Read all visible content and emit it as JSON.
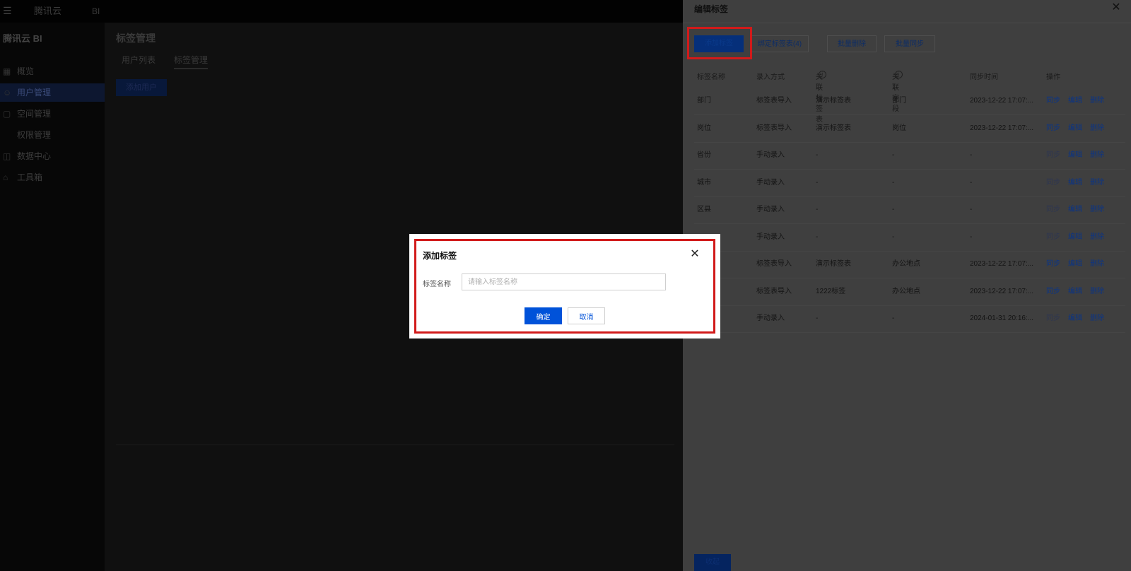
{
  "app": {
    "brand_logo": "腾讯云",
    "product": "BI",
    "sidebar_brand": "腾讯云 BI"
  },
  "sidebar": {
    "items": [
      {
        "label": "概览",
        "icon": "overview-icon"
      },
      {
        "label": "用户管理",
        "icon": "user-icon"
      },
      {
        "label": "空间管理",
        "icon": "space-icon"
      },
      {
        "label": "权限管理",
        "icon": "permission-icon"
      },
      {
        "label": "数据中心",
        "icon": "data-icon"
      },
      {
        "label": "工具箱",
        "icon": "toolbox-icon"
      }
    ]
  },
  "main": {
    "title": "标签管理",
    "tabs": [
      "用户列表",
      "标签管理"
    ],
    "add_button": "添加用户"
  },
  "drawer": {
    "title": "编辑标签",
    "toolbar": {
      "add": "添加标签",
      "bind": "绑定标签表(4)",
      "batch_delete": "批量删除",
      "batch_sync": "批量同步"
    },
    "columns": [
      "标签名称",
      "录入方式",
      "关联标签表",
      "关联字段",
      "同步时间",
      "操作"
    ],
    "rows": [
      {
        "name": "部门",
        "mode": "标签表导入",
        "table": "演示标签表",
        "field": "部门",
        "time": "2023-12-22 17:07:...",
        "sync": "同步",
        "edit": "编辑",
        "del": "删除",
        "sync_enabled": true
      },
      {
        "name": "岗位",
        "mode": "标签表导入",
        "table": "演示标签表",
        "field": "岗位",
        "time": "2023-12-22 17:07:...",
        "sync": "同步",
        "edit": "编辑",
        "del": "删除",
        "sync_enabled": true
      },
      {
        "name": "省份",
        "mode": "手动录入",
        "table": "-",
        "field": "-",
        "time": "-",
        "sync": "同步",
        "edit": "编辑",
        "del": "删除",
        "sync_enabled": false
      },
      {
        "name": "城市",
        "mode": "手动录入",
        "table": "-",
        "field": "-",
        "time": "-",
        "sync": "同步",
        "edit": "编辑",
        "del": "删除",
        "sync_enabled": false
      },
      {
        "name": "区县",
        "mode": "手动录入",
        "table": "-",
        "field": "-",
        "time": "-",
        "sync": "同步",
        "edit": "编辑",
        "del": "删除",
        "sync_enabled": false
      },
      {
        "name": "",
        "mode": "手动录入",
        "table": "-",
        "field": "-",
        "time": "-",
        "sync": "同步",
        "edit": "编辑",
        "del": "删除",
        "sync_enabled": false
      },
      {
        "name": "",
        "mode": "标签表导入",
        "table": "演示标签表",
        "field": "办公地点",
        "time": "2023-12-22 17:07:...",
        "sync": "同步",
        "edit": "编辑",
        "del": "删除",
        "sync_enabled": true
      },
      {
        "name": "",
        "mode": "标签表导入",
        "table": "1222标签",
        "field": "办公地点",
        "time": "2023-12-22 17:07:...",
        "sync": "同步",
        "edit": "编辑",
        "del": "删除",
        "sync_enabled": true
      },
      {
        "name": "",
        "mode": "手动录入",
        "table": "-",
        "field": "-",
        "time": "2024-01-31 20:16:...",
        "sync": "同步",
        "edit": "编辑",
        "del": "删除",
        "sync_enabled": false
      }
    ],
    "footer_button": "收起"
  },
  "dialog": {
    "title": "添加标签",
    "field_label": "标签名称",
    "field_placeholder": "请输入标签名称",
    "field_value": "",
    "confirm": "确定",
    "cancel": "取消"
  },
  "colors": {
    "primary": "#0052d9",
    "highlight": "#d11a1a"
  }
}
